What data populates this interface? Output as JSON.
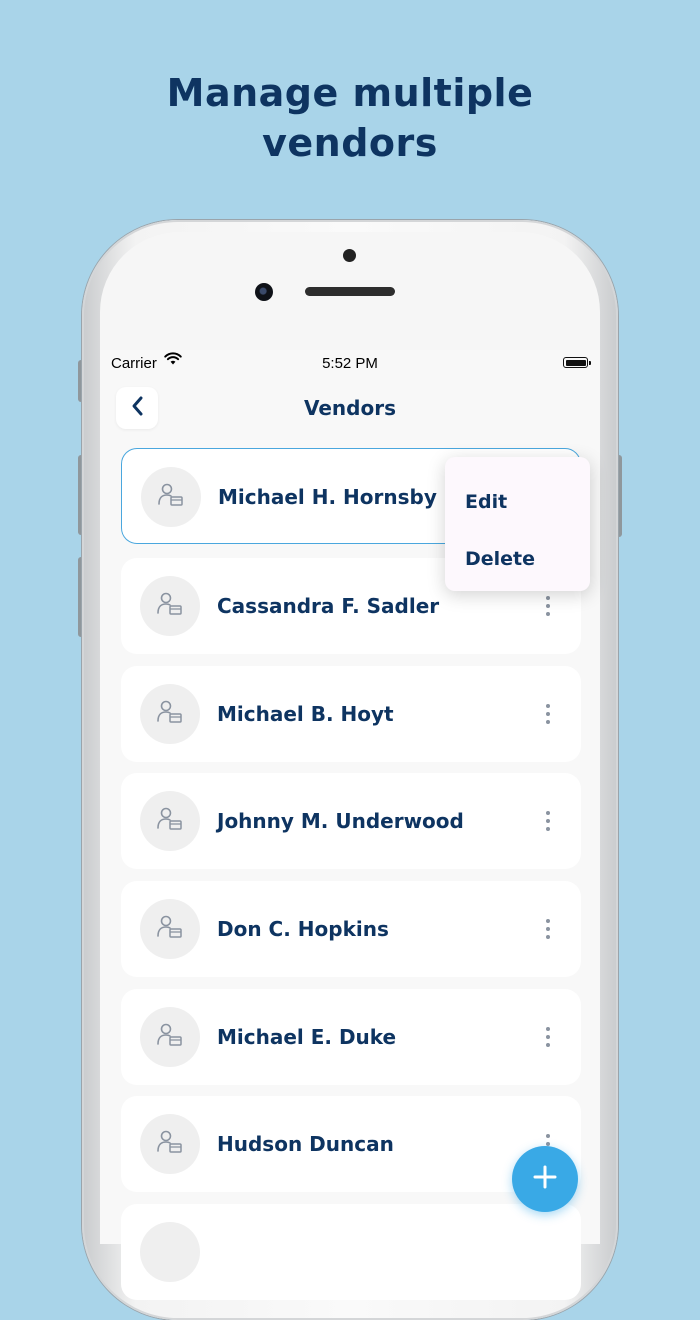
{
  "headline": {
    "line1": "Manage multiple",
    "line2": "vendors"
  },
  "status_bar": {
    "carrier": "Carrier",
    "time": "5:52 PM"
  },
  "nav": {
    "title": "Vendors"
  },
  "vendors": [
    {
      "name": "Michael H. Hornsby",
      "selected": true
    },
    {
      "name": "Cassandra F. Sadler"
    },
    {
      "name": "Michael B. Hoyt"
    },
    {
      "name": "Johnny M. Underwood"
    },
    {
      "name": "Don C. Hopkins"
    },
    {
      "name": "Michael E. Duke"
    },
    {
      "name": "Hudson Duncan"
    }
  ],
  "context_menu": {
    "edit_label": "Edit",
    "delete_label": "Delete"
  },
  "icons": {
    "back": "chevron-left-icon",
    "vendor": "vendor-person-icon",
    "more": "more-vertical-icon",
    "add": "plus-icon",
    "wifi": "wifi-icon",
    "battery": "battery-icon"
  },
  "colors": {
    "background": "#a9d4e9",
    "primary_text": "#0e3461",
    "accent": "#39a9e6",
    "selected_border": "#4aa7de"
  }
}
